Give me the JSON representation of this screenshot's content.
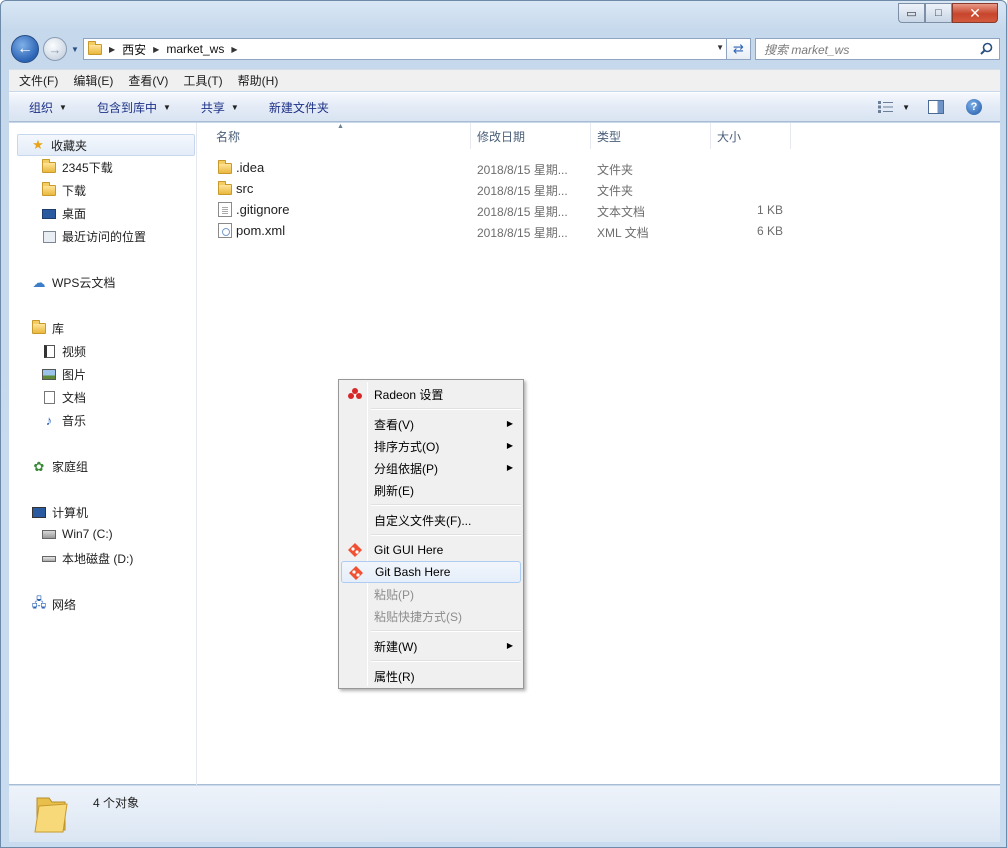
{
  "window": {
    "caption": {
      "minimize": "▭",
      "maximize": "□",
      "close": "✕"
    }
  },
  "address": {
    "breadcrumb": [
      "西安",
      "market_ws"
    ],
    "search_placeholder": "搜索 market_ws"
  },
  "menubar": [
    "文件(F)",
    "编辑(E)",
    "查看(V)",
    "工具(T)",
    "帮助(H)"
  ],
  "toolbar": {
    "organize": "组织",
    "include_in_library": "包含到库中",
    "share": "共享",
    "new_folder": "新建文件夹"
  },
  "nav": {
    "favorites": "收藏夹",
    "fav_items": [
      "2345下载",
      "下载",
      "桌面",
      "最近访问的位置"
    ],
    "wps": "WPS云文档",
    "libraries": "库",
    "lib_items": [
      "视频",
      "图片",
      "文档",
      "音乐"
    ],
    "homegroup": "家庭组",
    "computer": "计算机",
    "drives": [
      "Win7 (C:)",
      "本地磁盘 (D:)"
    ],
    "network": "网络"
  },
  "columns": [
    "名称",
    "修改日期",
    "类型",
    "大小"
  ],
  "files": [
    {
      "name": ".idea",
      "date": "2018/8/15 星期...",
      "type": "文件夹",
      "size": "",
      "icon": "folder-icon"
    },
    {
      "name": "src",
      "date": "2018/8/15 星期...",
      "type": "文件夹",
      "size": "",
      "icon": "folder-icon"
    },
    {
      "name": ".gitignore",
      "date": "2018/8/15 星期...",
      "type": "文本文档",
      "size": "1 KB",
      "icon": "text-file-icon"
    },
    {
      "name": "pom.xml",
      "date": "2018/8/15 星期...",
      "type": "XML 文档",
      "size": "6 KB",
      "icon": "xml-file-icon"
    }
  ],
  "status": {
    "count": "4 个对象"
  },
  "context_menu": {
    "radeon": "Radeon 设置",
    "view": "查看(V)",
    "sort_by": "排序方式(O)",
    "group_by": "分组依据(P)",
    "refresh": "刷新(E)",
    "customize_folder": "自定义文件夹(F)...",
    "git_gui": "Git GUI Here",
    "git_bash": "Git Bash Here",
    "paste": "粘贴(P)",
    "paste_shortcut": "粘贴快捷方式(S)",
    "new": "新建(W)",
    "properties": "属性(R)"
  },
  "colors": {
    "link_blue": "#1e3287",
    "hover_border": "#aeccf1",
    "radeon_red": "#d62828",
    "git_orange": "#f05133"
  }
}
